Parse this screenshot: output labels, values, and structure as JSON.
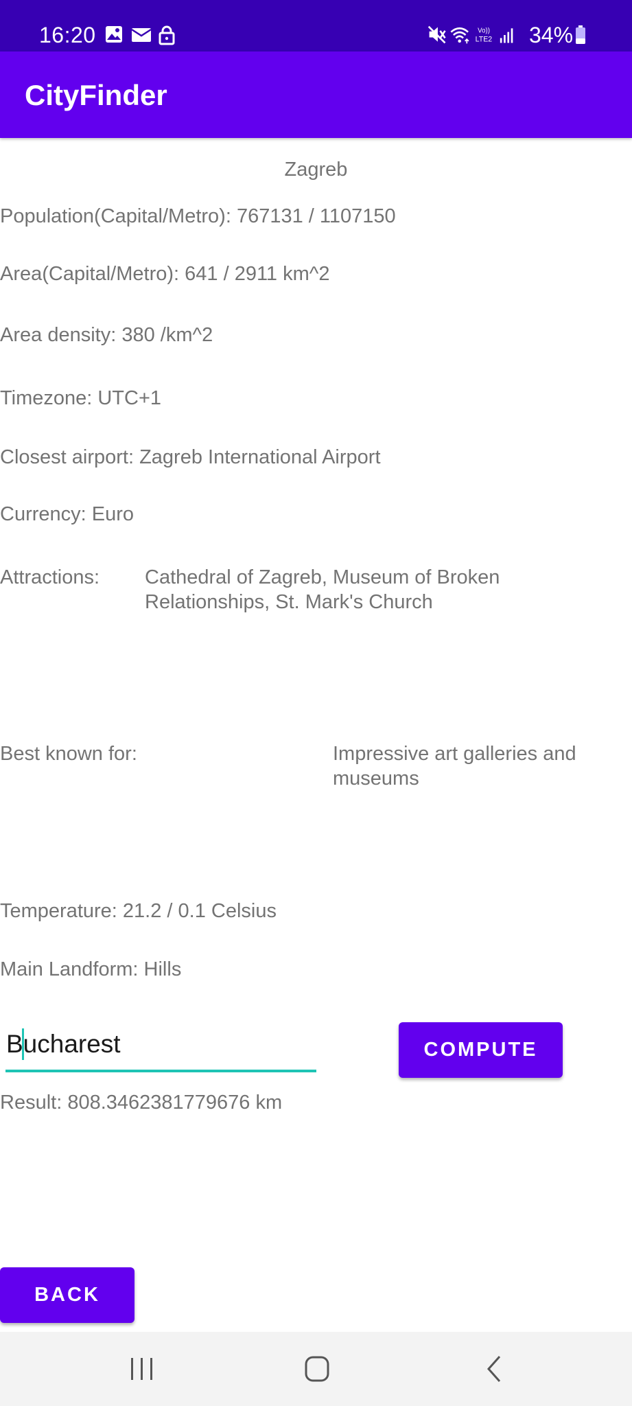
{
  "status_bar": {
    "time": "16:20",
    "battery_percent": "34%",
    "battery_level": 0.34,
    "left_icons": [
      "gallery-icon",
      "mail-icon",
      "lock-icon"
    ],
    "right_icons": [
      "mute-icon",
      "wifi-icon",
      "volte-icon",
      "signal-icon",
      "battery-icon"
    ],
    "volte_label_top": "Vo))",
    "volte_label_bottom": "LTE2"
  },
  "app_bar": {
    "title": "CityFinder",
    "color": "#6200ee"
  },
  "city": {
    "name": "Zagreb",
    "population": "Population(Capital/Metro): 767131 / 1107150",
    "area": "Area(Capital/Metro): 641 / 2911 km^2",
    "density": "Area density: 380 /km^2",
    "timezone": "Timezone: UTC+1",
    "airport": "Closest airport: Zagreb International Airport",
    "currency": "Currency: Euro",
    "attractions_label": "Attractions:",
    "attractions_value": "Cathedral of Zagreb, Museum of Broken Relationships, St. Mark's Church",
    "best_known_label": "Best known for:",
    "best_known_value": "Impressive art galleries and museums",
    "temperature": "Temperature: 21.2 / 0.1 Celsius",
    "landform": "Main Landform: Hills"
  },
  "distance": {
    "input_value": "Bucharest",
    "compute_label": "COMPUTE",
    "result": "Result: 808.3462381779676 km",
    "accent_color": "#1fc4b5"
  },
  "back_label": "BACK",
  "nav_bar": {
    "icons": [
      "recent-apps-icon",
      "home-icon",
      "back-icon"
    ]
  }
}
